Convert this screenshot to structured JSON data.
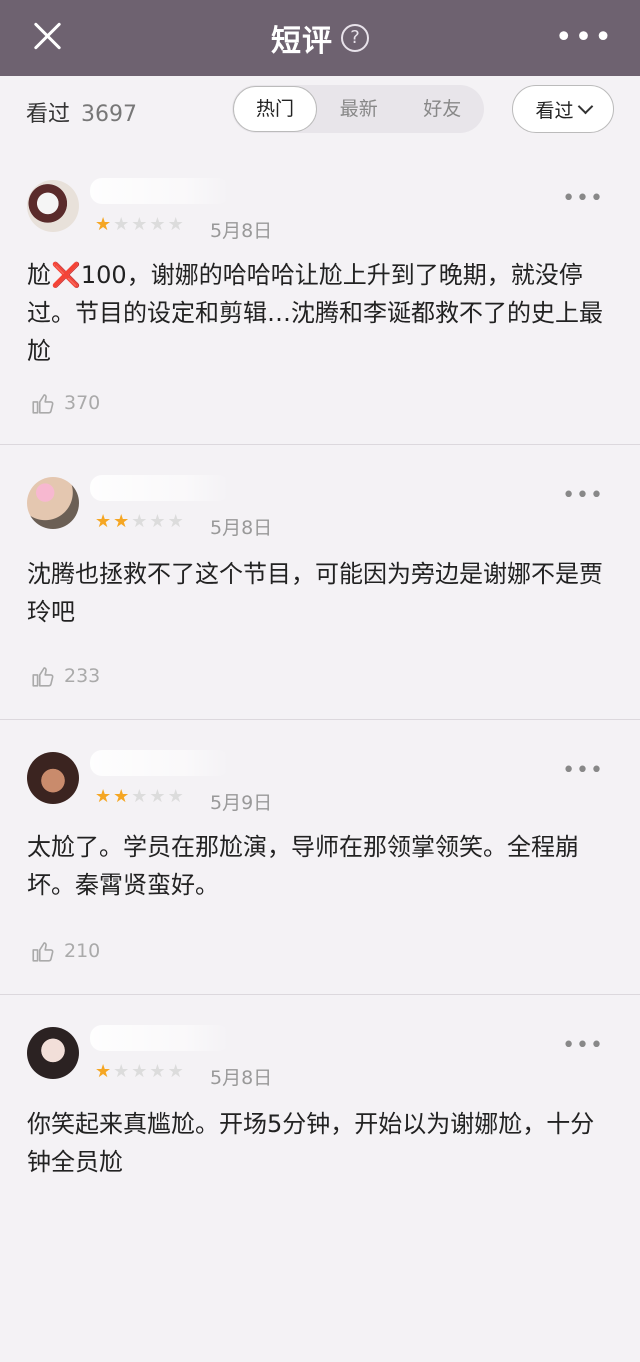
{
  "header": {
    "title": "短评",
    "help": "?",
    "more": "•••"
  },
  "filter": {
    "seen_label": "看过",
    "seen_count": "3697",
    "tabs": [
      "热门",
      "最新",
      "好友"
    ],
    "dropdown": "看过"
  },
  "reviews": [
    {
      "stars": 1,
      "date": "5月8日",
      "content": "尬❌100，谢娜的哈哈哈让尬上升到了晚期，就没停过。节目的设定和剪辑…沈腾和李诞都救不了的史上最尬",
      "likes": "370"
    },
    {
      "stars": 2,
      "date": "5月8日",
      "content": "沈腾也拯救不了这个节目，可能因为旁边是谢娜不是贾玲吧",
      "likes": "233"
    },
    {
      "stars": 2,
      "date": "5月9日",
      "content": "太尬了。学员在那尬演，导师在那领掌领笑。全程崩坏。秦霄贤蛮好。",
      "likes": "210"
    },
    {
      "stars": 1,
      "date": "5月8日",
      "content": "你笑起来真尴尬。开场5分钟，开始以为谢娜尬，十分钟全员尬",
      "likes": ""
    }
  ],
  "colors": {
    "header_bg": "#6e6270",
    "star": "#f5a623",
    "bg": "#f4f2f5"
  },
  "icons": {
    "close": "close-icon",
    "help": "question-circle-icon",
    "more": "more-icon",
    "like": "thumbs-up-icon"
  }
}
